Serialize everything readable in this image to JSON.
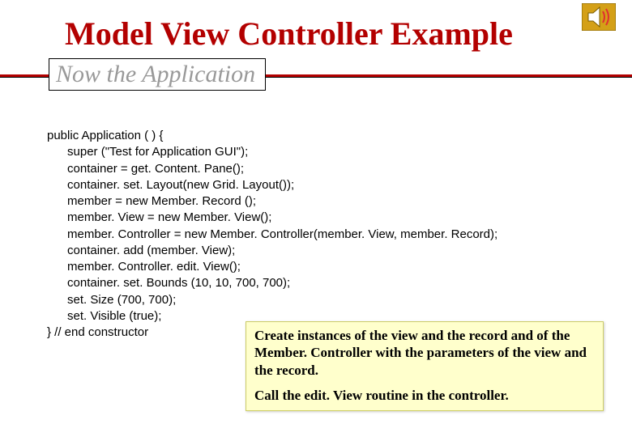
{
  "title": "Model View Controller Example",
  "subtitle": "Now the Application",
  "code_lines": [
    "public Application ( ) {",
    "      super (\"Test for Application GUI\");",
    "      container = get. Content. Pane();",
    "      container. set. Layout(new Grid. Layout());",
    "      member = new Member. Record ();",
    "      member. View = new Member. View();",
    "      member. Controller = new Member. Controller(member. View, member. Record);",
    "      container. add (member. View);",
    "      member. Controller. edit. View();",
    "      container. set. Bounds (10, 10, 700, 700);",
    "      set. Size (700, 700);",
    "      set. Visible (true);",
    "} // end constructor"
  ],
  "callout": {
    "para1": "Create instances of the view and the record and of the  Member. Controller with the parameters of the view and the record.",
    "para2": "Call the edit. View routine in the controller."
  },
  "icons": {
    "sound": "sound-icon"
  }
}
